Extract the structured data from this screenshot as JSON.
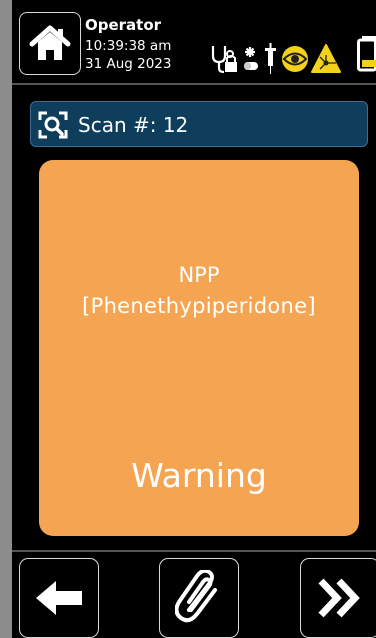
{
  "header": {
    "operator_label": "Operator",
    "time": "10:39:38 am",
    "date": "31 Aug 2023",
    "home_icon": "home-icon",
    "hazard_icons": [
      "stethoscope-lock-icon",
      "biohazard-capsule-icon",
      "syringe-icon",
      "eye-warning-icon",
      "laser-warning-icon"
    ],
    "battery_icon": "battery-low-icon"
  },
  "scan": {
    "label": "Scan #: 12",
    "icon": "scan-search-icon"
  },
  "result": {
    "code": "NPP",
    "name": "[Phenethypiperidone]",
    "status": "Warning",
    "color": "#f5a552"
  },
  "footer": {
    "back_icon": "arrow-left-icon",
    "attach_icon": "paperclip-icon",
    "next_icon": "double-chevron-right-icon"
  },
  "colors": {
    "background": "#000000",
    "scan_bar": "#0e3e5c",
    "warning": "#f5a552",
    "hazard_yellow": "#f2d21a"
  }
}
